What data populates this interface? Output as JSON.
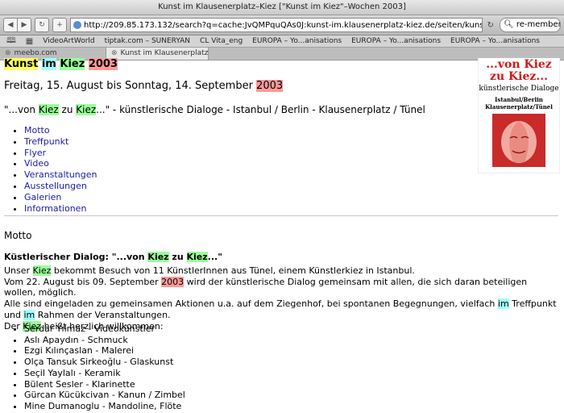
{
  "window_title": "Kunst im Klausenerplatz–Kiez [\"Kunst im Kiez\"–Wochen 2003]",
  "toolbar": {
    "url": "http://209.85.173.132/search?q=cache:JvQMPquQAs0J:kunst-im.klausenerplatz-kiez.de/seiten/kunstimkiez/kik2003.",
    "search_value": "re-member l"
  },
  "bookmarks": [
    "VideoArtWorld",
    "tiptak.com – SUNERYAN",
    "CL Vita_eng",
    "EUROPA – Yo...anisations",
    "EUROPA – Yo...anisations",
    "EUROPA – Yo...anisations"
  ],
  "tabs": [
    {
      "label": "meebo.com"
    },
    {
      "label": "Kunst im Klausenerplatz..."
    }
  ],
  "page": {
    "title": {
      "w1": "Kunst",
      "w2": "im",
      "w3": "Kiez",
      "w4": "2003"
    },
    "dates": {
      "prefix": "Freitag, 15. August bis Sonntag, 14. September ",
      "year": "2003"
    },
    "subtitle": {
      "q1": "\"...von ",
      "kiez1": "Kiez",
      "zu": " zu ",
      "kiez2": "Kiez",
      "rest": "...\" - künstlerische Dialoge - Istanbul / Berlin - Klausenerplatz / Tünel"
    },
    "toc": [
      "Motto",
      "Treffpunkt",
      "Flyer",
      "Video",
      "Veranstaltungen",
      "Ausstellungen",
      "Galerien",
      "Informationen"
    ],
    "poster": {
      "line1": "...von Kiez",
      "line2": "zu Kiez...",
      "subtitle": "künstlerische Dialoge",
      "loc1": "Istanbul/Berlin",
      "loc2": "Klausenerplatz/Tünel"
    },
    "section_title": "Motto",
    "dialog": {
      "prefix": "Küstlerischer Dialog: \"...von ",
      "kiez1": "Kiez",
      "zu": " zu ",
      "kiez2": "Kiez",
      "suffix": "...\""
    },
    "body": {
      "l1a": "Unser ",
      "l1k": "Kiez",
      "l1b": " bekommt Besuch von 11 KünstlerInnen aus Tünel, einem Künstlerkiez in Istanbul.",
      "l2a": "Vom 22. August bis 09. September ",
      "l2y": "2003",
      "l2b": " wird der künstlerische Dialog gemeinsam mit allen, die sich daran beteiligen wollen, möglich.",
      "l3a": "Alle sind eingeladen zu gemeinsamen Aktionen u.a. auf dem Ziegenhof, bei spontanen Begegnungen, vielfach ",
      "l3im1": "im",
      "l3b": " Treffpunkt und ",
      "l3im2": "im",
      "l3c": " Rahmen der Veranstaltungen.",
      "l4a": "Der ",
      "l4k": "Kiez",
      "l4b": " heißt herzlich willkommen:"
    },
    "artists": [
      "Serdar Yılmaz - Videokünstler",
      "Aslı Apaydın - Schmuck",
      "Ezgi Kılınçaslan - Malerei",
      "Olça Tansuk Sirkeoğlu - Glaskunst",
      "Seçil Yaylalı - Keramik",
      "Bülent Sesler - Klarinette",
      "Gürcan Kücükcivan - Kanun / Zimbel",
      "Mine Dumanoglu - Mandoline, Flöte"
    ]
  }
}
